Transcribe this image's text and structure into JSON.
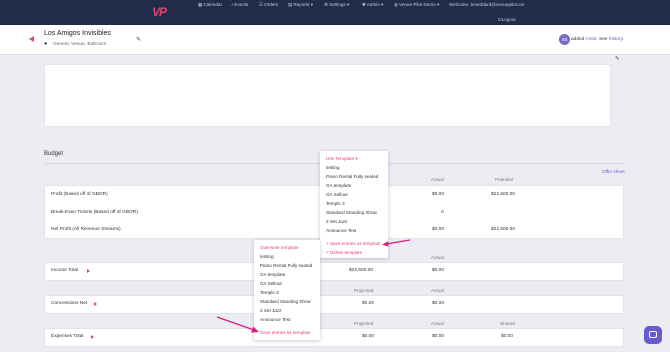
{
  "nav": {
    "items": [
      {
        "icon": "calendar-icon",
        "glyph": "▦",
        "label": "Calendar"
      },
      {
        "icon": "events-icon",
        "glyph": "♪",
        "label": "Events"
      },
      {
        "icon": "orders-icon",
        "glyph": "☰",
        "label": "Orders"
      },
      {
        "icon": "reports-icon",
        "glyph": "▤",
        "label": "Reports ▾"
      },
      {
        "icon": "settings-icon",
        "glyph": "⚙",
        "label": "Settings ▾"
      },
      {
        "icon": "admin-icon",
        "glyph": "✱",
        "label": "Admin ▾"
      },
      {
        "icon": "globe-icon",
        "glyph": "◍",
        "label": "Venue Pilot Demo ▾"
      },
      {
        "icon": "",
        "glyph": "",
        "label": "Welcome, bmeddard@venuepilot.co!"
      }
    ],
    "logout": "Logout"
  },
  "header": {
    "title": "Los Amigos Invisibles",
    "venue": "Generic Venue, Ballroom",
    "avatar_initials": "SS",
    "activity_pre": "added ",
    "activity_link1": "Artist",
    "activity_mid": ". See ",
    "activity_link2": "history",
    "activity_end": "."
  },
  "budget": {
    "heading": "Budget",
    "offer_link": "Offer sheet",
    "col_actual": "Actual",
    "col_potential": "Potential",
    "col_projected": "Projected",
    "col_shared": "Shared",
    "summary_rows": [
      {
        "label": "Profit (Based off of GBOR)",
        "actual": "$0.00",
        "potential": "$22,500.00"
      },
      {
        "label": "Break-Even Tickets (Based off of GBOR)",
        "actual": "0",
        "potential": ""
      },
      {
        "label": "Net Profit (All Revenue Streams)",
        "actual": "$0.00",
        "potential": "$22,500.00"
      }
    ],
    "income": {
      "label": "Income Total",
      "projected": "$22,500.00",
      "actual": "$0.00"
    },
    "concessions": {
      "label": "Concessions Net",
      "projected": "$0.00",
      "actual": "$0.00"
    },
    "expenses": {
      "label": "Expenses Total",
      "projected": "$0.00",
      "actual": "$0.00",
      "shared": "$0.00"
    }
  },
  "template_menu_top": {
    "header": "Use Template ▾",
    "items": [
      "testing",
      "Piano Rental Fully seated",
      "GA template",
      "GA Sellout",
      "Temple 3",
      "Standard Standing Show",
      "2 Set Jazz",
      "Announce Test"
    ],
    "save": "+ Save entries as template",
    "delete": "× Delete template"
  },
  "template_menu_bottom": {
    "header": "Overwrite template",
    "items": [
      "testing",
      "Piano Rental Fully seated",
      "GA template",
      "GA Sellout",
      "Temple 3",
      "Standard Standing Show",
      "2 Set Jazz",
      "Announce Test"
    ],
    "save": "Save entries as template"
  },
  "colors": {
    "nav_bg": "#212c4a",
    "accent": "#e4436d",
    "link": "#6a5ad0",
    "bg": "#ecedf3"
  }
}
